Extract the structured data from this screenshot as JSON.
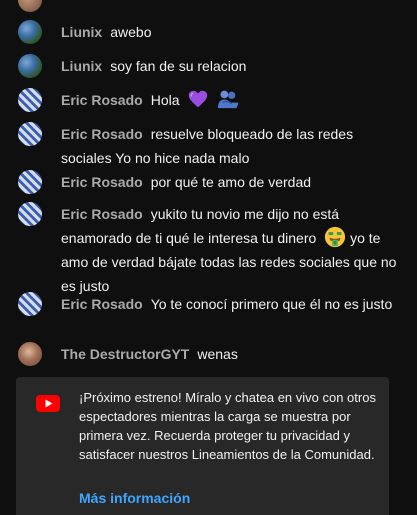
{
  "messages": [
    {
      "author": "Liunix",
      "text": "awebo",
      "avatar": "liunix-avatar"
    },
    {
      "author": "Liunix",
      "text": "soy fan de su relacion",
      "avatar": "liunix-avatar"
    },
    {
      "author": "Eric Rosado",
      "text": "Hola",
      "avatar": "eric-avatar",
      "emojis": [
        "purple-heart-icon",
        "people-hugging-icon"
      ]
    },
    {
      "author": "Eric Rosado",
      "text": "resuelve bloqueado de las redes sociales Yo no hice nada malo",
      "avatar": "eric-avatar"
    },
    {
      "author": "Eric Rosado",
      "text": "por qué te amo de verdad",
      "avatar": "eric-avatar"
    },
    {
      "author": "Eric Rosado",
      "text_before": "yukito tu novio me dijo no está enamorado de ti qué le interesa tu dinero",
      "text_after": "yo te amo de verdad bájate todas las redes sociales que no es justo",
      "avatar": "eric-avatar",
      "emojis": [
        "money-mouth-face-icon"
      ]
    },
    {
      "author": "Eric Rosado",
      "text": "Yo te conocí primero que él no es justo",
      "avatar": "eric-avatar"
    },
    {
      "author": "The DestructorGYT",
      "text": "wenas",
      "avatar": "destructor-avatar"
    }
  ],
  "notice": {
    "icon": "youtube-icon",
    "text": "¡Próximo estreno! Míralo y chatea en vivo con otros espectadores mientras la carga se muestra por primera vez. Recuerda proteger tu privacidad y satisfacer nuestros Lineamientos de la Comunidad.",
    "link": "Más información"
  },
  "colors": {
    "background": "#0f0f0f",
    "author": "#aaaaaa",
    "message": "#f1f1f1",
    "notice_bg": "#282828",
    "link": "#3ea6ff",
    "youtube_red": "#ff0000"
  }
}
